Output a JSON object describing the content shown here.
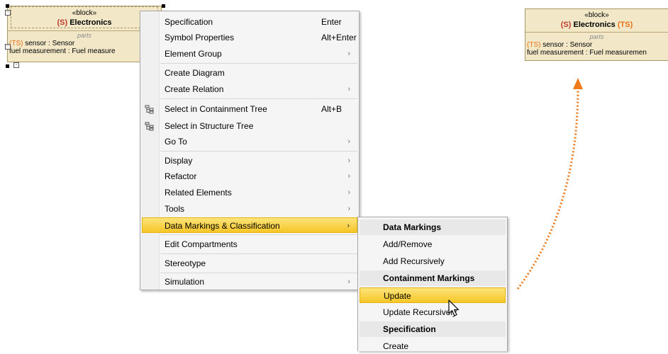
{
  "left_block": {
    "stereotype": "«block»",
    "marking": "(S)",
    "name": "Electronics",
    "compartment": "parts",
    "rows": [
      {
        "marking": "(TS)",
        "text": " sensor : Sensor"
      },
      {
        "marking": "",
        "text": "fuel measurement  : Fuel measure"
      }
    ]
  },
  "right_block": {
    "stereotype": "«block»",
    "marking": "(S)",
    "name": "Electronics",
    "title_marking": "(TS)",
    "compartment": "parts",
    "rows": [
      {
        "marking": "(TS)",
        "text": " sensor : Sensor"
      },
      {
        "marking": "",
        "text": "fuel measurement  : Fuel measuremen"
      }
    ]
  },
  "context_menu": {
    "items": [
      {
        "label": "Specification",
        "shortcut": "Enter",
        "submenu": false
      },
      {
        "label": "Symbol Properties",
        "shortcut": "Alt+Enter",
        "submenu": false
      },
      {
        "label": "Element Group",
        "shortcut": "",
        "submenu": true
      },
      {
        "label": "Create Diagram",
        "shortcut": "",
        "submenu": false
      },
      {
        "label": "Create Relation",
        "shortcut": "",
        "submenu": true
      },
      {
        "label": "Select in Containment Tree",
        "shortcut": "Alt+B",
        "submenu": false,
        "icon": "containment-tree-icon"
      },
      {
        "label": "Select in Structure Tree",
        "shortcut": "",
        "submenu": false,
        "icon": "structure-tree-icon"
      },
      {
        "label": "Go To",
        "shortcut": "",
        "submenu": true
      },
      {
        "label": "Display",
        "shortcut": "",
        "submenu": true
      },
      {
        "label": "Refactor",
        "shortcut": "",
        "submenu": true
      },
      {
        "label": "Related Elements",
        "shortcut": "",
        "submenu": true
      },
      {
        "label": "Tools",
        "shortcut": "",
        "submenu": true
      },
      {
        "label": "Data Markings & Classification",
        "shortcut": "",
        "submenu": true,
        "highlighted": true
      },
      {
        "label": "Edit Compartments",
        "shortcut": "",
        "submenu": false
      },
      {
        "label": "Stereotype",
        "shortcut": "",
        "submenu": false
      },
      {
        "label": "Simulation",
        "shortcut": "",
        "submenu": true
      }
    ],
    "arrow_glyph": "›"
  },
  "sub_menu": {
    "items": [
      {
        "label": "Data Markings",
        "type": "header"
      },
      {
        "label": "Add/Remove",
        "type": "item"
      },
      {
        "label": "Add Recursively",
        "type": "item"
      },
      {
        "label": "Containment Markings",
        "type": "header"
      },
      {
        "label": "Update",
        "type": "item",
        "highlighted": true
      },
      {
        "label": "Update Recursively",
        "type": "item"
      },
      {
        "label": "Specification",
        "type": "header"
      },
      {
        "label": "Create",
        "type": "item"
      }
    ]
  },
  "colors": {
    "block_fill": "#f2e8c8",
    "marking_orange": "#e8731c",
    "highlight": "#f6c627",
    "arrow": "#f07a1a"
  }
}
